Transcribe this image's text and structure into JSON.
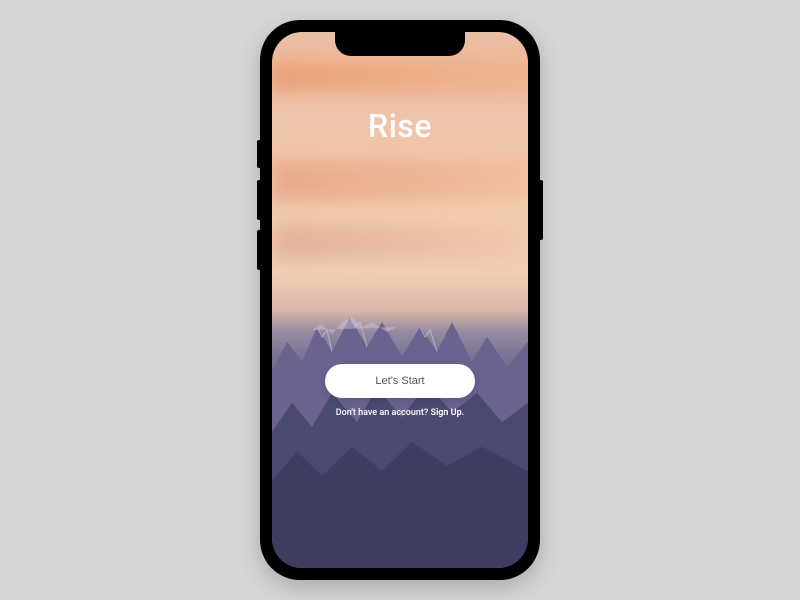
{
  "app": {
    "title": "Rise"
  },
  "actions": {
    "start_button_label": "Let's Start",
    "signup_prompt": "Don't have an account? ",
    "signup_link": "Sign Up."
  },
  "theme": {
    "sky_top": "#e8c0a8",
    "sky_mid": "#f5cfb0",
    "mountain_back": "#6d6592",
    "mountain_front": "#4b4a70",
    "button_bg": "#ffffff",
    "text_light": "#ffffff"
  }
}
